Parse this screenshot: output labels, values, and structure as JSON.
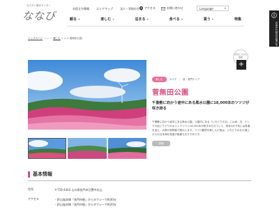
{
  "logo": {
    "sub": "なすがく観光センター",
    "main": "ななび"
  },
  "topnav": [
    "お役立ち情報",
    "エリアマップ",
    "法人・学校の方へ"
  ],
  "utility": {
    "access": "アクセス",
    "contact": "お問い合わせ",
    "language": "Language"
  },
  "mainnav": [
    "観る",
    "楽しむ",
    "泊まる",
    "食べる",
    "買う",
    "特集"
  ],
  "side_tab": "お出かけ前のお役立ち",
  "breadcrumb": {
    "top": "トップページ",
    "sep": "> > >",
    "cat": "楽しむ",
    "tail": "> > > 菅無田公園"
  },
  "badge": "お気に入りに追加",
  "tags": {
    "pill": "楽しむ",
    "area": "エリア",
    "sep": "|",
    "loc": "萩・長門エリア"
  },
  "place": {
    "title": "菅無田公園",
    "catch": "千畳敷に向かう途中にある風水公園に18,000本のツツジが咲き誇る",
    "desc": "千畳敷に向かう途中にある風水公園。公園内にある「いろどりの丘」には赤、白、ピンクの色とりどりのキリシマツツジ18,000本が咲きみだれていて、例年4月下旬には見頃を迎え、大勢の見物客で賑わいます。ツツジ観賞を楽しんだ後は、いろどりの丘の頂上からの日本海を見渡す絶景もおすすめです。",
    "detail_button": "詳細"
  },
  "basic": {
    "title": "基本情報",
    "address_label": "住所",
    "address": "〒759-4402 山口県長門市日置中北山",
    "access_label": "アクセス",
    "access_lines": [
      "・JR山陰本線「長門市駅」からタクシーで約30分",
      "・JR山陰本線「長門市駅」からタクシーで約20分"
    ]
  },
  "colors": {
    "accent": "#d9517e",
    "pill": "#e6719a",
    "dark": "#222222"
  }
}
